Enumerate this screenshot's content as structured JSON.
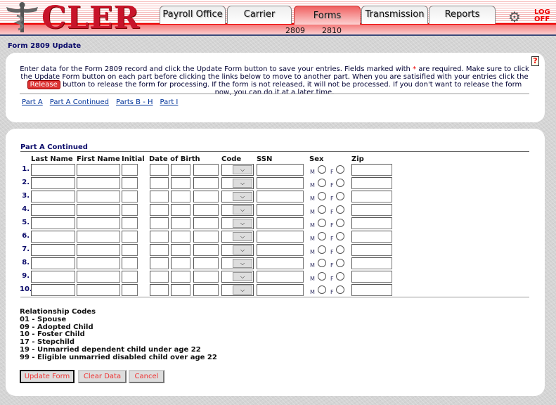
{
  "header": {
    "logo_text": "CLER",
    "tabs": [
      {
        "label": "Payroll Office"
      },
      {
        "label": "Carrier"
      },
      {
        "label": "Forms",
        "active": true
      },
      {
        "label": "Transmission"
      },
      {
        "label": "Reports"
      }
    ],
    "subnav": [
      "2809",
      "2810"
    ],
    "logoff_line1": "LOG",
    "logoff_line2": "OFF"
  },
  "page_title": "Form 2809 Update",
  "intro": {
    "part1": "Enter data for the Form 2809 record and click the Update Form button to save your entries.  Fields marked with",
    "star": "*",
    "part2": "are required.  Make sure to click the Update Form button on each part before clicking the links below to move to another part.  When you are satisified with your entries click the",
    "release": "Release",
    "part3": "button to release the form for processing.  If the form is not released, it will not be processed.  If you don't want to release the form now, you can do it at a later time."
  },
  "links": [
    "Part A",
    "Part A Continued",
    "Parts B - H",
    "Part I"
  ],
  "section_title": "Part A Continued",
  "columns": {
    "last": "Last Name",
    "first": "First Name",
    "initial": "Initial",
    "dob": "Date of Birth",
    "code": "Code",
    "ssn": "SSN",
    "sex": "Sex",
    "zip": "Zip"
  },
  "rows": [
    "1.",
    "2.",
    "3.",
    "4.",
    "5.",
    "6.",
    "7.",
    "8.",
    "9.",
    "10."
  ],
  "sex_labels": {
    "m": "M",
    "f": "F"
  },
  "codes": {
    "title": "Relationship Codes",
    "items": [
      "01 - Spouse",
      "09 - Adopted Child",
      "10 - Foster Child",
      "17 - Stepchild",
      "19 - Unmarried dependent child under age 22",
      "99 - Eligible unmarried disabled child over age 22"
    ]
  },
  "buttons": {
    "update": "Update Form",
    "clear": "Clear Data",
    "cancel": "Cancel"
  },
  "colors": {
    "accent": "#e00000",
    "navy": "#0a0a6a"
  }
}
